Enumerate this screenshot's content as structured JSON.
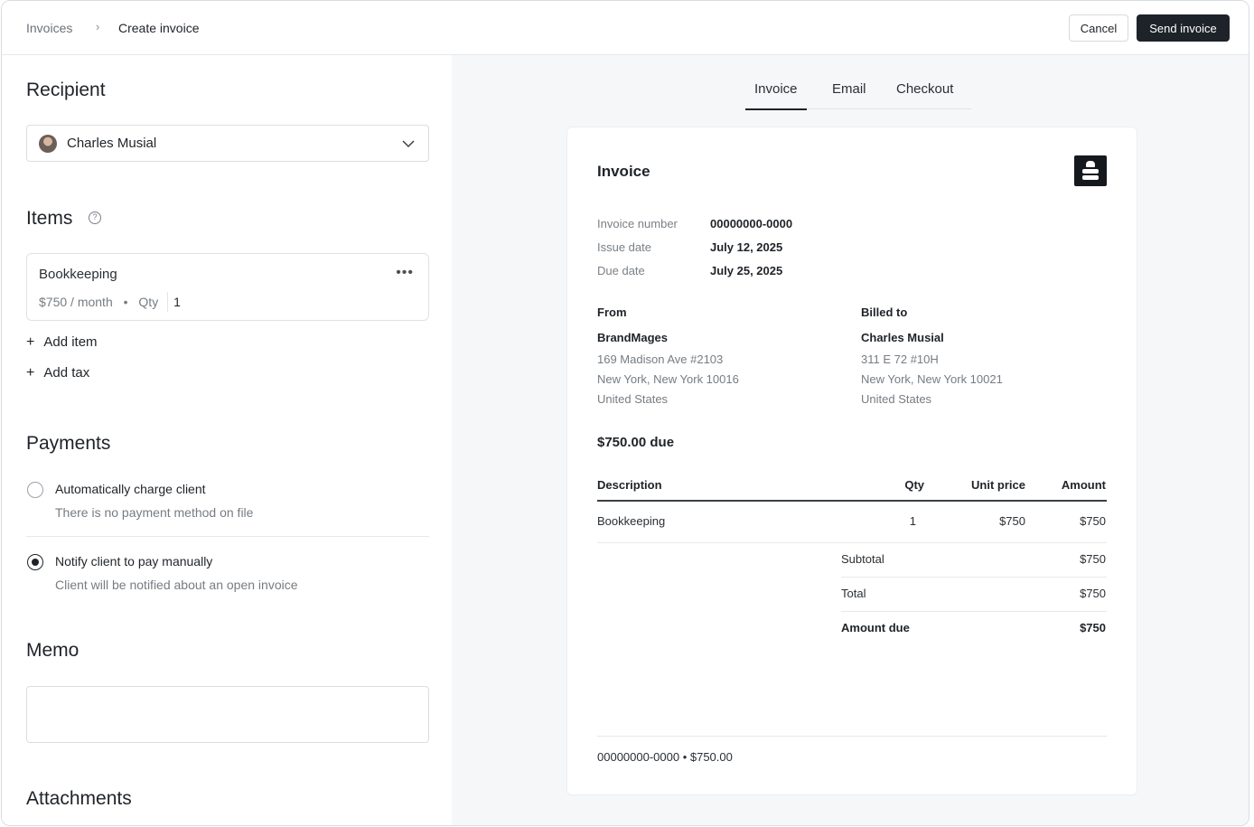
{
  "breadcrumb": {
    "parent": "Invoices",
    "separator": "›",
    "current": "Create invoice"
  },
  "actions": {
    "cancel": "Cancel",
    "send": "Send invoice"
  },
  "recipient": {
    "heading": "Recipient",
    "selected": "Charles Musial"
  },
  "items": {
    "heading": "Items",
    "list": [
      {
        "name": "Bookkeeping",
        "price": "$750 / month",
        "qty_label": "Qty",
        "qty": "1"
      }
    ],
    "add_item": "Add item",
    "add_tax": "Add tax"
  },
  "payments": {
    "heading": "Payments",
    "options": [
      {
        "title": "Automatically charge client",
        "subtitle": "There is no payment method on file",
        "selected": false
      },
      {
        "title": "Notify client to pay manually",
        "subtitle": "Client will be notified about an open invoice",
        "selected": true
      }
    ]
  },
  "memo": {
    "heading": "Memo",
    "value": ""
  },
  "attachments": {
    "heading": "Attachments"
  },
  "preview_tabs": [
    {
      "label": "Invoice",
      "active": true
    },
    {
      "label": "Email",
      "active": false
    },
    {
      "label": "Checkout",
      "active": false
    }
  ],
  "invoice": {
    "title": "Invoice",
    "meta": [
      {
        "label": "Invoice number",
        "value": "00000000-0000"
      },
      {
        "label": "Issue date",
        "value": "July 12, 2025"
      },
      {
        "label": "Due date",
        "value": "July 25, 2025"
      }
    ],
    "from": {
      "heading": "From",
      "name": "BrandMages",
      "lines": [
        "169 Madison Ave #2103",
        "New York, New York 10016",
        "United States"
      ]
    },
    "billed_to": {
      "heading": "Billed to",
      "name": "Charles Musial",
      "lines": [
        "311 E 72 #10H",
        "New York, New York 10021",
        "United States"
      ]
    },
    "amount_due_text": "$750.00 due",
    "table": {
      "headers": {
        "description": "Description",
        "qty": "Qty",
        "unit_price": "Unit price",
        "amount": "Amount"
      },
      "rows": [
        {
          "description": "Bookkeeping",
          "qty": "1",
          "unit_price": "$750",
          "amount": "$750"
        }
      ]
    },
    "summary": [
      {
        "label": "Subtotal",
        "value": "$750"
      },
      {
        "label": "Total",
        "value": "$750"
      },
      {
        "label": "Amount due",
        "value": "$750"
      }
    ],
    "footer": "00000000-0000 • $750.00"
  }
}
